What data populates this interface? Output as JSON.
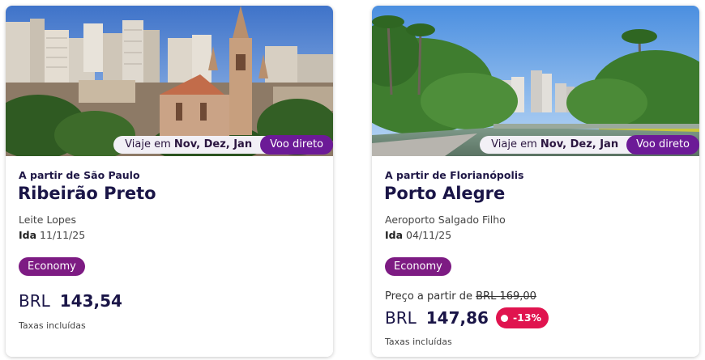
{
  "cards": [
    {
      "pill_prefix": "Viaje em",
      "pill_months": "Nov, Dez, Jan",
      "direct_label": "Voo direto",
      "from": "A partir de São Paulo",
      "city": "Ribeirão Preto",
      "airport": "Leite Lopes",
      "date_label": "Ida",
      "date_value": "11/11/25",
      "cabin": "Economy",
      "currency": "BRL",
      "price": "143,54",
      "taxes": "Taxas incluídas"
    },
    {
      "pill_prefix": "Viaje em",
      "pill_months": "Nov, Dez, Jan",
      "direct_label": "Voo direto",
      "from": "A partir de Florianópolis",
      "city": "Porto Alegre",
      "airport": "Aeroporto Salgado Filho",
      "date_label": "Ida",
      "date_value": "04/11/25",
      "cabin": "Economy",
      "price_from_label": "Preço a partir de",
      "old_price": "BRL 169,00",
      "currency": "BRL",
      "price": "147,86",
      "discount": "-13%",
      "taxes": "Taxas incluídas"
    }
  ],
  "colors": {
    "brand_purple": "#6c1a97",
    "cabin_purple": "#7d1b83",
    "discount_red": "#e0144f",
    "text_navy": "#1a1547"
  }
}
